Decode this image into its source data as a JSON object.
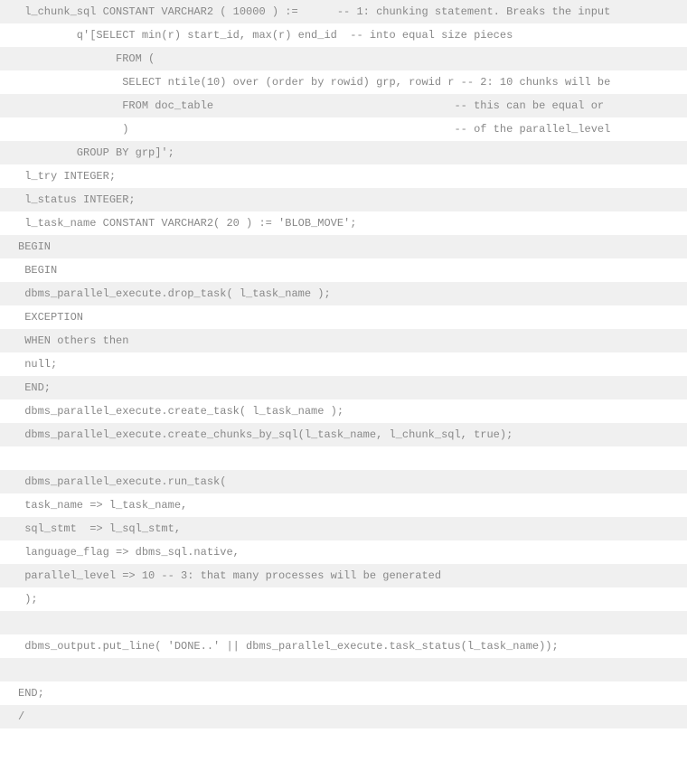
{
  "code": {
    "lines": [
      " l_chunk_sql CONSTANT VARCHAR2 ( 10000 ) :=      -- 1: chunking statement. Breaks the input",
      "         q'[SELECT min(r) start_id, max(r) end_id  -- into equal size pieces",
      "               FROM ( ",
      "                SELECT ntile(10) over (order by rowid) grp, rowid r -- 2: 10 chunks will be",
      "                FROM doc_table                                     -- this can be equal or",
      "                )                                                  -- of the parallel_level",
      "         GROUP BY grp]';",
      " l_try INTEGER;",
      " l_status INTEGER;",
      " l_task_name CONSTANT VARCHAR2( 20 ) := 'BLOB_MOVE';",
      "BEGIN",
      " BEGIN",
      " dbms_parallel_execute.drop_task( l_task_name );",
      " EXCEPTION",
      " WHEN others then",
      " null;",
      " END;",
      " dbms_parallel_execute.create_task( l_task_name );",
      " dbms_parallel_execute.create_chunks_by_sql(l_task_name, l_chunk_sql, true);",
      " ",
      " dbms_parallel_execute.run_task( ",
      " task_name => l_task_name,",
      " sql_stmt  => l_sql_stmt,",
      " language_flag => dbms_sql.native,",
      " parallel_level => 10 -- 3: that many processes will be generated",
      " );",
      " ",
      " dbms_output.put_line( 'DONE..' || dbms_parallel_execute.task_status(l_task_name));",
      " ",
      "END;",
      "/"
    ]
  }
}
